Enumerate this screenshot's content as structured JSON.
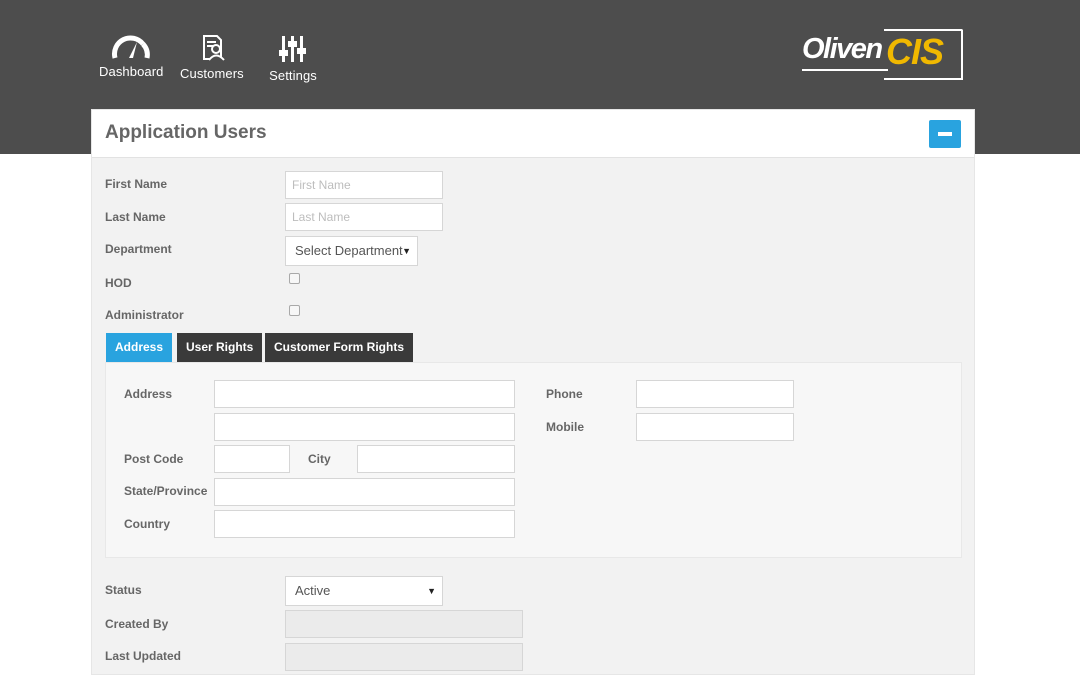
{
  "nav": {
    "items": [
      {
        "label": "Dashboard",
        "icon": "gauge-icon"
      },
      {
        "label": "Customers",
        "icon": "customer-document-icon"
      },
      {
        "label": "Settings",
        "icon": "sliders-icon"
      }
    ],
    "logo": {
      "prefix": "Oliven",
      "suffix": "CIS"
    }
  },
  "panel": {
    "title": "Application Users",
    "collapse_icon": "minus-icon"
  },
  "form": {
    "first_name": {
      "label": "First Name",
      "placeholder": "First Name",
      "value": ""
    },
    "last_name": {
      "label": "Last Name",
      "placeholder": "Last Name",
      "value": ""
    },
    "department": {
      "label": "Department",
      "selected": "Select Department"
    },
    "hod": {
      "label": "HOD",
      "checked": false
    },
    "administrator": {
      "label": "Administrator",
      "checked": false
    }
  },
  "tabs": [
    {
      "label": "Address",
      "active": true
    },
    {
      "label": "User Rights",
      "active": false
    },
    {
      "label": "Customer Form Rights",
      "active": false
    }
  ],
  "address": {
    "address_label": "Address",
    "post_code_label": "Post Code",
    "city_label": "City",
    "state_label": "State/Province",
    "country_label": "Country",
    "phone_label": "Phone",
    "mobile_label": "Mobile"
  },
  "meta": {
    "status": {
      "label": "Status",
      "selected": "Active"
    },
    "created_by": {
      "label": "Created By",
      "value": ""
    },
    "last_updated": {
      "label": "Last Updated",
      "value": ""
    }
  },
  "colors": {
    "topbar": "#4d4d4d",
    "accent": "#29a3df",
    "logo_yellow": "#f0b800",
    "tab_dark": "#3a3a3a"
  }
}
